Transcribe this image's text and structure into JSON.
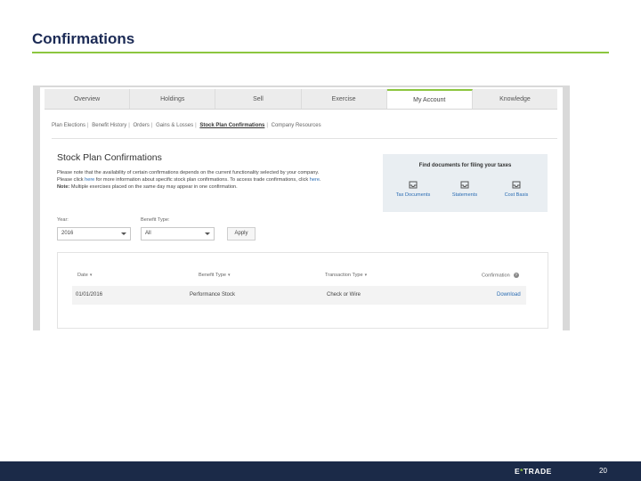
{
  "slide": {
    "title": "Confirmations",
    "page_number": "20",
    "logo": {
      "pre": "E",
      "mark": "*",
      "post": "TRADE"
    }
  },
  "screenshot": {
    "nav_tabs": [
      "Overview",
      "Holdings",
      "Sell",
      "Exercise",
      "My Account",
      "Knowledge"
    ],
    "active_tab": "My Account",
    "subnav": [
      "Plan Elections",
      "Benefit History",
      "Orders",
      "Gains & Losses",
      "Stock Plan Confirmations",
      "Company Resources"
    ],
    "heading": "Stock Plan Confirmations",
    "notice": {
      "line1": "Please note that the availability of certain confirmations depends on the current functionality selected by your company.",
      "line2_a": "Please click ",
      "line2_link1": "here",
      "line2_b": " for more information about specific stock plan confirmations. To access trade confirmations, click ",
      "line2_link2": "here",
      "line2_c": ".",
      "line3_bold": "Note:",
      "line3": " Multiple exercises placed on the same day may appear in one confirmation."
    },
    "tax_box": {
      "title": "Find documents for filing your taxes",
      "items": [
        {
          "label": "Tax Documents",
          "icon": "inbox-icon"
        },
        {
          "label": "Statements",
          "icon": "inbox-icon"
        },
        {
          "label": "Cost Basis",
          "icon": "inbox-icon"
        }
      ]
    },
    "filters": {
      "year_label": "Year:",
      "year_value": "2016",
      "benefit_label": "Benefit Type:",
      "benefit_value": "All",
      "apply_label": "Apply"
    },
    "table": {
      "headers": {
        "date": "Date",
        "benefit_type": "Benefit Type",
        "transaction_type": "Transaction Type",
        "confirmation": "Confirmation"
      },
      "rows": [
        {
          "date": "01/01/2016",
          "benefit_type": "Performance Stock",
          "transaction_type": "Check or Wire",
          "confirmation": "Download"
        }
      ]
    }
  },
  "colors": {
    "accent_green": "#8cc63f",
    "footer_navy": "#1b2a48",
    "title_navy": "#1b2a55",
    "link_blue": "#2a6cb3"
  }
}
